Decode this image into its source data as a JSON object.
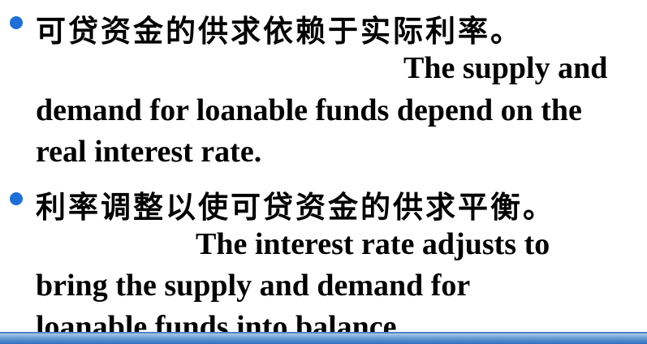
{
  "bullets": [
    {
      "chinese": "可贷资金的供求依赖于实际利率。",
      "english_lines": [
        "The supply and",
        "demand for loanable funds depend on the",
        "real interest rate."
      ]
    },
    {
      "chinese": "利率调整以使可贷资金的供求平衡。",
      "english_lines": [
        "The interest rate adjusts to",
        "bring the supply and demand for",
        "loanable funds into balance."
      ]
    }
  ],
  "colors": {
    "bullet": "#1f6fd6",
    "text": "#000000",
    "footer_bar": "#2f6fbf"
  }
}
